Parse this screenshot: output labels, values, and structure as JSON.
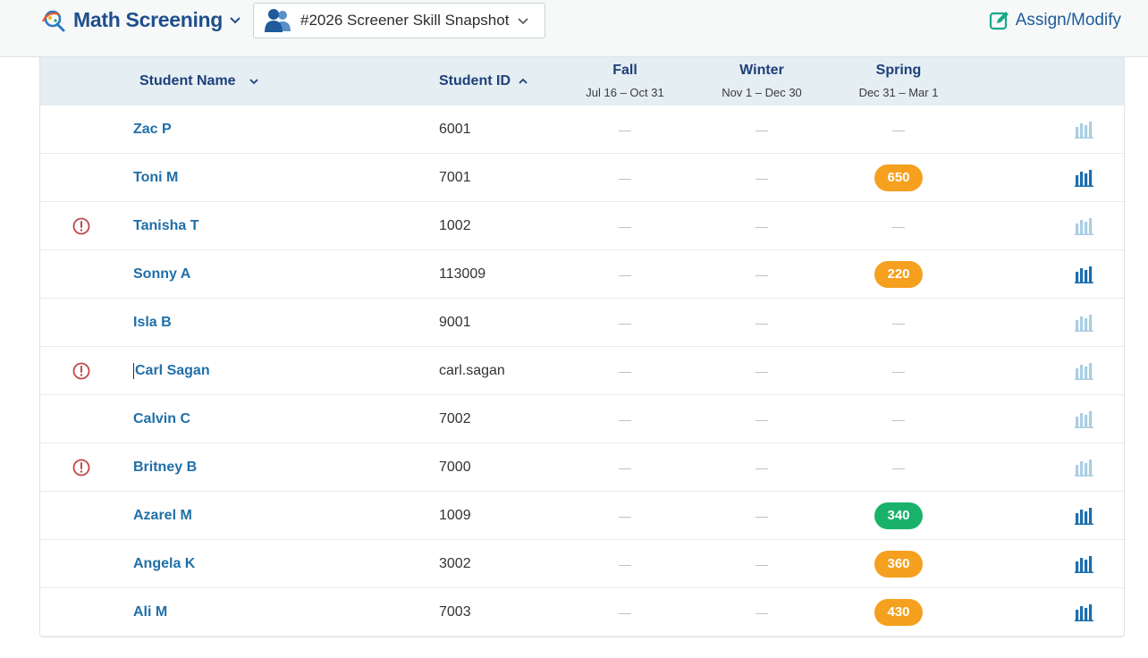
{
  "header": {
    "app_title": "Math Screening",
    "snapshot_label": "#2026 Screener Skill Snapshot",
    "assign_label": "Assign/Modify"
  },
  "table": {
    "columns": {
      "name": "Student Name",
      "id": "Student ID",
      "fall": "Fall",
      "fall_range": "Jul 16 – Oct 31",
      "winter": "Winter",
      "winter_range": "Nov 1 – Dec 30",
      "spring": "Spring",
      "spring_range": "Dec 31 – Mar 1"
    },
    "empty_marker": "—",
    "rows": [
      {
        "name": "Zac P",
        "id": "6001",
        "warning": false,
        "fall": "—",
        "winter": "—",
        "spring": "—",
        "spring_status": "none",
        "has_report": false
      },
      {
        "name": "Toni M",
        "id": "7001",
        "warning": false,
        "fall": "—",
        "winter": "—",
        "spring": "650",
        "spring_status": "orange",
        "has_report": true
      },
      {
        "name": "Tanisha T",
        "id": "1002",
        "warning": true,
        "fall": "—",
        "winter": "—",
        "spring": "—",
        "spring_status": "none",
        "has_report": false
      },
      {
        "name": "Sonny A",
        "id": "113009",
        "warning": false,
        "fall": "—",
        "winter": "—",
        "spring": "220",
        "spring_status": "orange",
        "has_report": true
      },
      {
        "name": "Isla B",
        "id": "9001",
        "warning": false,
        "fall": "—",
        "winter": "—",
        "spring": "—",
        "spring_status": "none",
        "has_report": false
      },
      {
        "name": "Carl Sagan",
        "id": "carl.sagan",
        "warning": true,
        "fall": "—",
        "winter": "—",
        "spring": "—",
        "spring_status": "none",
        "has_report": false
      },
      {
        "name": "Calvin C",
        "id": "7002",
        "warning": false,
        "fall": "—",
        "winter": "—",
        "spring": "—",
        "spring_status": "none",
        "has_report": false
      },
      {
        "name": "Britney B",
        "id": "7000",
        "warning": true,
        "fall": "—",
        "winter": "—",
        "spring": "—",
        "spring_status": "none",
        "has_report": false
      },
      {
        "name": "Azarel M",
        "id": "1009",
        "warning": false,
        "fall": "—",
        "winter": "—",
        "spring": "340",
        "spring_status": "green",
        "has_report": true
      },
      {
        "name": "Angela K",
        "id": "3002",
        "warning": false,
        "fall": "—",
        "winter": "—",
        "spring": "360",
        "spring_status": "orange",
        "has_report": true
      },
      {
        "name": "Ali M",
        "id": "7003",
        "warning": false,
        "fall": "—",
        "winter": "—",
        "spring": "430",
        "spring_status": "orange",
        "has_report": true
      }
    ]
  },
  "icons": {
    "app_logo": "math-screening-logo-icon",
    "app_menu": "chevron-down-icon",
    "snapshot": "people-group-icon",
    "assign": "pencil-square-icon",
    "sort_name": "chevron-down-icon",
    "sort_id": "chevron-up-icon",
    "warning": "exclamation-circle-icon",
    "report": "bar-chart-icon"
  },
  "colors": {
    "brand_blue": "#1f4f8c",
    "link_blue": "#1f6fa8",
    "header_bg": "#e4eef3",
    "orange_score": "#f5a01e",
    "green_score": "#1ab26b",
    "warning_red": "#c0474a",
    "report_active": "#1a6fae",
    "report_inactive": "#a9cde3"
  }
}
